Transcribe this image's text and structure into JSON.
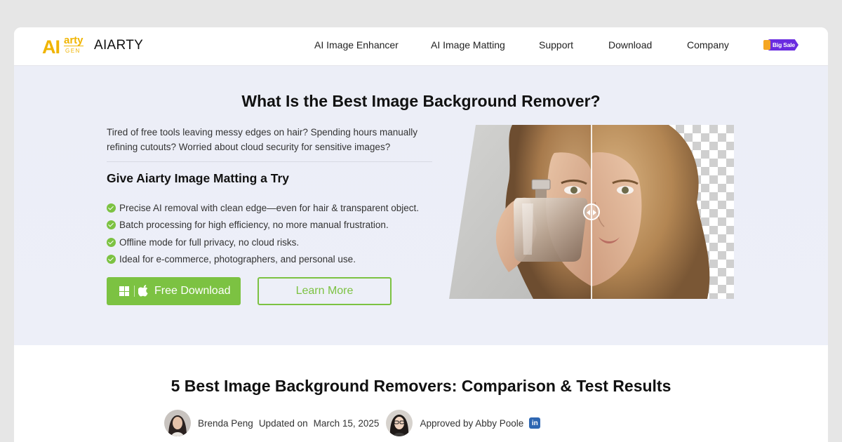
{
  "header": {
    "logo": {
      "mark_ai": "AI",
      "mark_arty": "arty",
      "mark_gen": "GEN",
      "brand": "AIARTY"
    },
    "nav": [
      {
        "label": "AI Image Enhancer"
      },
      {
        "label": "AI Image Matting"
      },
      {
        "label": "Support"
      },
      {
        "label": "Download"
      },
      {
        "label": "Company"
      }
    ],
    "promo": {
      "label": "Big Sale",
      "icon": "gift-icon",
      "color": "#6a2be0"
    }
  },
  "hero": {
    "title": "What Is the Best Image Background Remover?",
    "intro": "Tired of free tools leaving messy edges on hair? Spending hours manually refining cutouts? Worried about cloud security for sensitive images?",
    "subtitle": "Give Aiarty Image Matting a Try",
    "features": [
      "Precise AI removal with clean edge—even for hair & transparent object.",
      "Batch processing for high efficiency, no more manual frustration.",
      "Offline mode for full privacy, no cloud risks.",
      "Ideal for e-commerce, photographers, and personal use."
    ],
    "download_button": "Free Download",
    "learn_button": "Learn More",
    "image": {
      "description_icon": "before-after-comparison-slider",
      "accent": "#7cc242"
    }
  },
  "article": {
    "title": "5 Best Image Background Removers: Comparison & Test Results",
    "author": "Brenda Peng",
    "updated_label": "Updated on",
    "date": "March 15, 2025",
    "approved": "Approved by Abby Poole",
    "social_icon": "in"
  },
  "colors": {
    "accent_green": "#7cc242",
    "logo_yellow": "#f0b400",
    "hero_bg": "#eceef7"
  }
}
